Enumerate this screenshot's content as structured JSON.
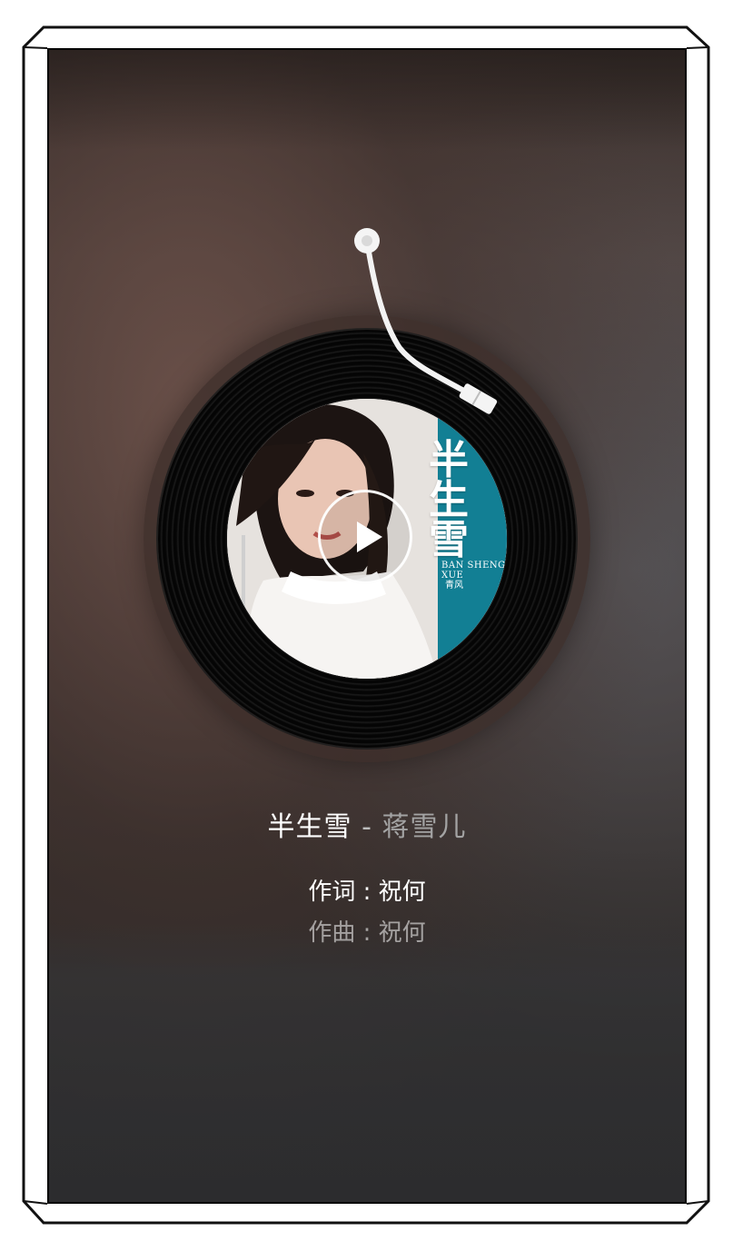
{
  "album": {
    "cover_title": "半生雪",
    "cover_subtitle": "BAN SHENG XUE",
    "cover_seal": "青风"
  },
  "song": {
    "title": "半生雪",
    "separator": "-",
    "artist": "蒋雪儿"
  },
  "lyrics": [
    "作词 : 祝何",
    "作曲 : 祝何"
  ],
  "controls": {
    "play_icon": "play-icon",
    "tonearm_icon": "tonearm-icon"
  },
  "colors": {
    "cover_accent": "#127f94",
    "artist_text": "#a3a3a3"
  }
}
